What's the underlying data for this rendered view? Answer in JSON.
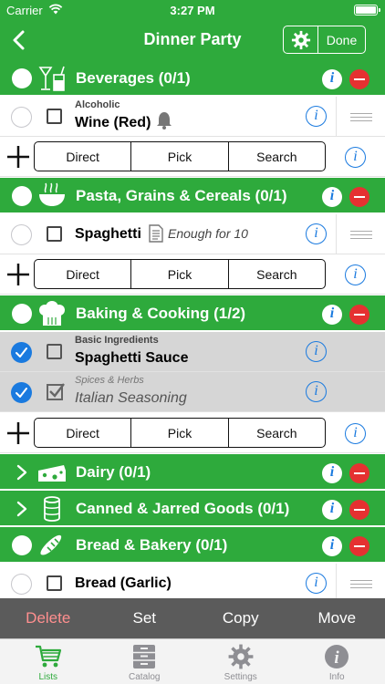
{
  "status_bar": {
    "carrier": "Carrier",
    "time": "3:27 PM"
  },
  "nav": {
    "title": "Dinner Party",
    "done_label": "Done"
  },
  "colors": {
    "accent": "#2eaa3c",
    "info_blue": "#1a7adf",
    "delete_red": "#e53131",
    "action_bar": "#5b5b5b"
  },
  "categories": [
    {
      "name": "Beverages (0/1)",
      "icon": "drinks-icon",
      "expanded": true,
      "items": [
        {
          "subtitle": "Alcoholic",
          "name": "Wine (Red)",
          "checked": false,
          "icon": "bell-icon"
        }
      ]
    },
    {
      "name": "Pasta, Grains & Cereals (0/1)",
      "icon": "bowl-icon",
      "expanded": true,
      "items": [
        {
          "name": "Spaghetti",
          "note": "Enough for 10",
          "checked": false,
          "icon": "note-icon"
        }
      ]
    },
    {
      "name": "Baking & Cooking (1/2)",
      "icon": "chef-hat-icon",
      "expanded": true,
      "items": [
        {
          "subtitle": "Basic Ingredients",
          "name": "Spaghetti Sauce",
          "checked": true
        },
        {
          "subtitle": "Spices & Herbs",
          "name": "Italian Seasoning",
          "checked": true,
          "crossed": true
        }
      ]
    },
    {
      "name": "Dairy (0/1)",
      "icon": "cheese-icon",
      "expanded": false
    },
    {
      "name": "Canned & Jarred Goods (0/1)",
      "icon": "can-icon",
      "expanded": false
    },
    {
      "name": "Bread & Bakery (0/1)",
      "icon": "bread-icon",
      "expanded": true,
      "items": [
        {
          "name": "Bread (Garlic)",
          "checked": false
        }
      ]
    }
  ],
  "add_row": {
    "direct": "Direct",
    "pick": "Pick",
    "search": "Search"
  },
  "info_glyph": "i",
  "actions": {
    "delete": "Delete",
    "set": "Set",
    "copy": "Copy",
    "move": "Move"
  },
  "tabs": [
    {
      "label": "Lists",
      "icon": "cart-icon",
      "active": true
    },
    {
      "label": "Catalog",
      "icon": "cabinet-icon",
      "active": false
    },
    {
      "label": "Settings",
      "icon": "gear-icon",
      "active": false
    },
    {
      "label": "Info",
      "icon": "info-icon",
      "active": false
    }
  ]
}
